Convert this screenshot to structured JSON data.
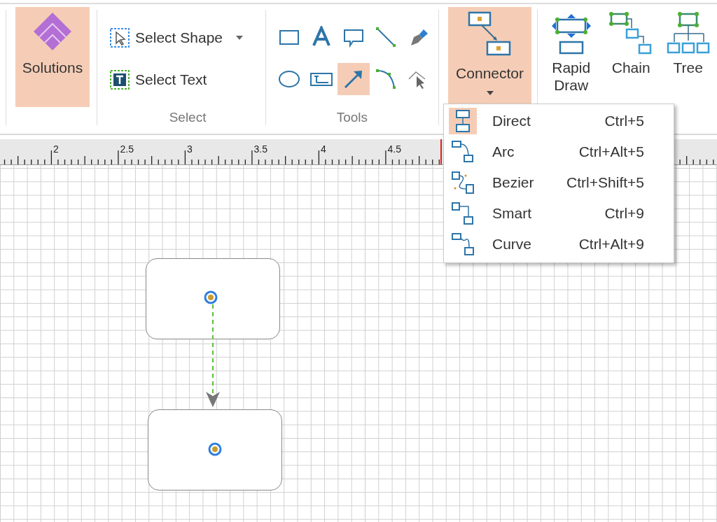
{
  "ribbon": {
    "solutions": {
      "label": "Solutions",
      "selected": true
    },
    "select_group": {
      "label": "Select",
      "items": [
        {
          "kind": "shape",
          "label": "Select Shape",
          "has_dropdown": true
        },
        {
          "kind": "text",
          "label": "Select Text",
          "has_dropdown": false
        }
      ]
    },
    "tools_group": {
      "label": "Tools",
      "tools": [
        {
          "kind": "rectangle",
          "selected": false
        },
        {
          "kind": "text",
          "selected": false
        },
        {
          "kind": "callout",
          "selected": false
        },
        {
          "kind": "line",
          "selected": false
        },
        {
          "kind": "pen",
          "selected": false
        },
        {
          "kind": "ellipse",
          "selected": false
        },
        {
          "kind": "textbox",
          "selected": false
        },
        {
          "kind": "arrow",
          "selected": true
        },
        {
          "kind": "arc",
          "selected": false
        },
        {
          "kind": "point",
          "selected": false
        }
      ]
    },
    "connector": {
      "label": "Connector",
      "selected": true,
      "expanded": true
    },
    "layouts": [
      {
        "kind": "rapid",
        "label": "Rapid\nDraw"
      },
      {
        "kind": "chain",
        "label": "Chain"
      },
      {
        "kind": "tree",
        "label": "Tree"
      }
    ]
  },
  "ruler": {
    "labels": [
      "2",
      "2.5",
      "3",
      "3.5",
      "4",
      "4.5"
    ]
  },
  "connector_menu": [
    {
      "kind": "direct",
      "label": "Direct",
      "shortcut": "Ctrl+5",
      "selected": true
    },
    {
      "kind": "arc",
      "label": "Arc",
      "shortcut": "Ctrl+Alt+5",
      "selected": false
    },
    {
      "kind": "bezier",
      "label": "Bezier",
      "shortcut": "Ctrl+Shift+5",
      "selected": false
    },
    {
      "kind": "smart",
      "label": "Smart",
      "shortcut": "Ctrl+9",
      "selected": false
    },
    {
      "kind": "curve",
      "label": "Curve",
      "shortcut": "Ctrl+Alt+9",
      "selected": false
    }
  ]
}
